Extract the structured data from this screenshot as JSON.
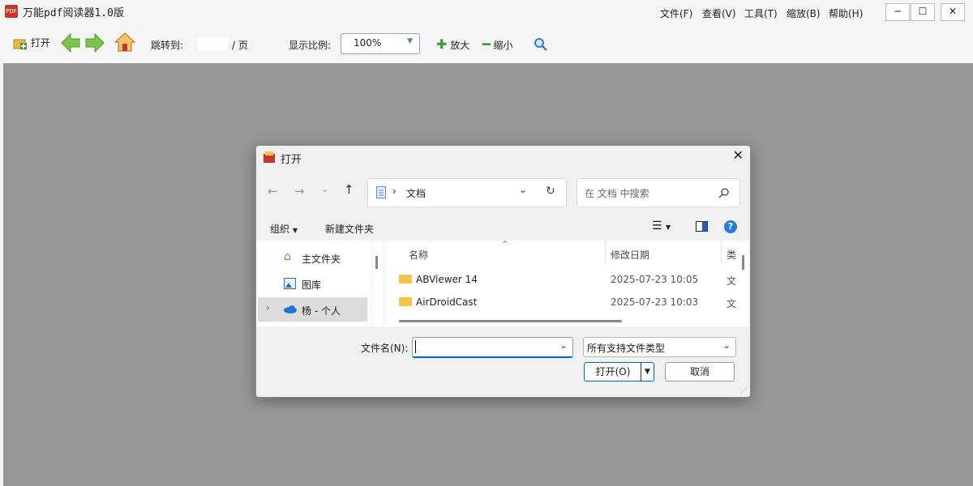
{
  "app": {
    "title": "万能pdf阅读器1.0版",
    "icon_label": "PDF",
    "menus": [
      "文件(F)",
      "查看(V)",
      "工具(T)",
      "缩放(B)",
      "帮助(H)"
    ],
    "window_buttons": [
      "─",
      "☐",
      "✕"
    ]
  },
  "toolbar": {
    "open_label": "打开",
    "goto_label": "跳转到:",
    "page_sep": "/ 页",
    "zoom_label": "显示比例:",
    "zoom_value": "100%",
    "zoom_in_label": "放大",
    "zoom_out_label": "缩小"
  },
  "dialog": {
    "title": "打开",
    "path_crumb": "文档",
    "search_placeholder": "在 文档 中搜索",
    "organize_label": "组织",
    "new_folder_label": "新建文件夹",
    "nav_items": [
      {
        "label": "主文件夹"
      },
      {
        "label": "图库"
      },
      {
        "label": "杨 - 个人"
      }
    ],
    "columns": {
      "name": "名称",
      "date": "修改日期",
      "type": "类"
    },
    "files": [
      {
        "name": "ABViewer 14",
        "date": "2025-07-23 10:05",
        "type": "文"
      },
      {
        "name": "AirDroidCast",
        "date": "2025-07-23 10:03",
        "type": "文"
      }
    ],
    "filename_label": "文件名(N):",
    "filename_value": "",
    "filetype_value": "所有支持文件类型",
    "open_button": "打开(O)",
    "cancel_button": "取消"
  },
  "colors": {
    "workspace_bg": "#979797",
    "accent": "#0067c0",
    "folder": "#f3c34a",
    "green_arrow": "#7cc34a"
  }
}
